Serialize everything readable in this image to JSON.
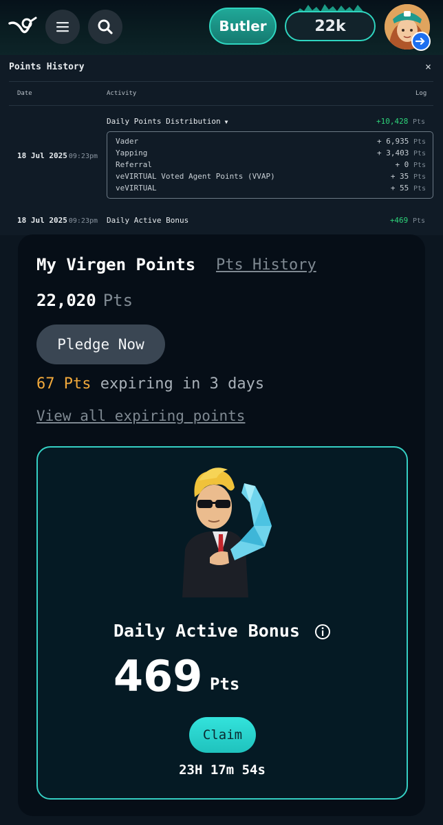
{
  "topbar": {
    "logo_icon": "virtuals-logo-icon",
    "menu_icon": "hamburger-menu-icon",
    "search_icon": "search-icon",
    "butler_label": "Butler",
    "points_short": "22k",
    "avatar": "user-avatar",
    "logout_icon": "logout-arrow-icon"
  },
  "history": {
    "title": "Points History",
    "close_label": "×",
    "columns": [
      "Date",
      "Activity",
      "Log"
    ],
    "distribution": {
      "date": "18 Jul 2025",
      "time": "09:23pm",
      "title": "Daily Points Distribution",
      "total": "+10,428",
      "unit": "Pts",
      "breakdown": [
        {
          "label": "Vader",
          "value": "+ 6,935",
          "unit": "Pts"
        },
        {
          "label": "Yapping",
          "value": "+ 3,403",
          "unit": "Pts"
        },
        {
          "label": "Referral",
          "value": "+ 0",
          "unit": "Pts"
        },
        {
          "label": "veVIRTUAL Voted Agent Points (VVAP)",
          "value": "+ 35",
          "unit": "Pts"
        },
        {
          "label": "veVIRTUAL",
          "value": "+ 55",
          "unit": "Pts"
        }
      ]
    },
    "daily_bonus_row": {
      "date": "18 Jul 2025",
      "time": "09:23pm",
      "activity": "Daily Active Bonus",
      "log": "+469",
      "unit": "Pts"
    }
  },
  "card": {
    "title": "My Virgen Points",
    "history_link": "Pts History",
    "balance": "22,020",
    "balance_unit": "Pts",
    "pledge_label": "Pledge Now",
    "expiring_amount": "67 Pts",
    "expiring_text": "expiring in 3 days",
    "view_expiring_label": "View all expiring points"
  },
  "bonus": {
    "title": "Daily Active Bonus",
    "value": "469",
    "unit": "Pts",
    "claim_label": "Claim",
    "countdown": "23H 17m 54s",
    "accent_color": "#35d0c4"
  }
}
